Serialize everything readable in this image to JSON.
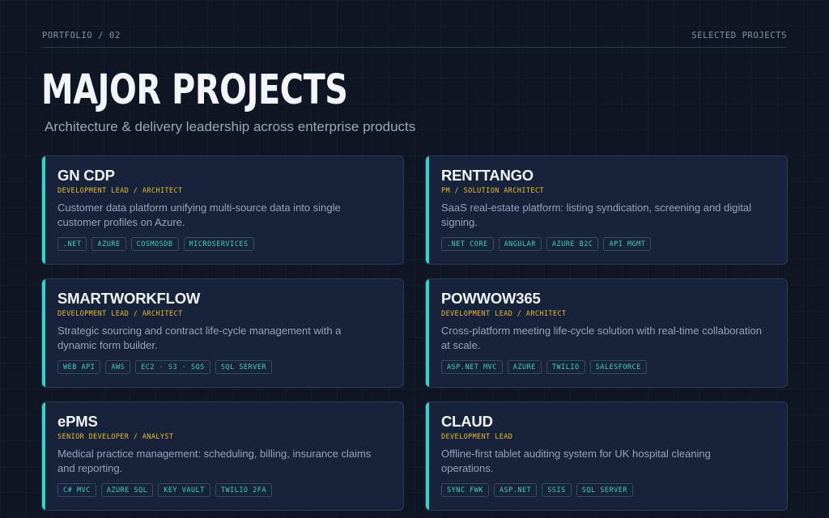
{
  "header": {
    "left_label": "PORTFOLIO / 02",
    "right_label": "SELECTED PROJECTS"
  },
  "title": "MAJOR PROJECTS",
  "subtitle": "Architecture & delivery leadership across enterprise products",
  "colors": {
    "background": "#0e1624",
    "card": "#17233a",
    "accent": "#2fd6c3",
    "role": "#e8b935",
    "tag_text": "#35d2bf"
  },
  "projects": [
    {
      "name": "GN CDP",
      "role": "DEVELOPMENT LEAD / ARCHITECT",
      "description": "Customer data platform unifying multi-source data into single customer profiles on Azure.",
      "tags": [
        ".NET",
        "AZURE",
        "COSMOSDB",
        "MICROSERVICES"
      ]
    },
    {
      "name": "RENTTANGO",
      "role": "PM / SOLUTION ARCHITECT",
      "description": "SaaS real-estate platform: listing syndication, screening and digital signing.",
      "tags": [
        ".NET CORE",
        "ANGULAR",
        "AZURE B2C",
        "API MGMT"
      ]
    },
    {
      "name": "SMARTWORKFLOW",
      "role": "DEVELOPMENT LEAD / ARCHITECT",
      "description": "Strategic sourcing and contract life-cycle management with a dynamic form builder.",
      "tags": [
        "WEB API",
        "AWS",
        "EC2 · S3 · SQS",
        "SQL SERVER"
      ]
    },
    {
      "name": "POWWOW365",
      "role": "DEVELOPMENT LEAD / ARCHITECT",
      "description": "Cross-platform meeting life-cycle solution with real-time collaboration at scale.",
      "tags": [
        "ASP.NET MVC",
        "AZURE",
        "TWILIO",
        "SALESFORCE"
      ]
    },
    {
      "name": "ePMS",
      "role": "SENIOR DEVELOPER / ANALYST",
      "description": "Medical practice management: scheduling, billing, insurance claims and reporting.",
      "tags": [
        "C# MVC",
        "AZURE SQL",
        "KEY VAULT",
        "TWILIO 2FA"
      ]
    },
    {
      "name": "CLAUD",
      "role": "DEVELOPMENT LEAD",
      "description": "Offline-first tablet auditing system for UK hospital cleaning operations.",
      "tags": [
        "SYNC FWK",
        "ASP.NET",
        "SSIS",
        "SQL SERVER"
      ]
    }
  ]
}
